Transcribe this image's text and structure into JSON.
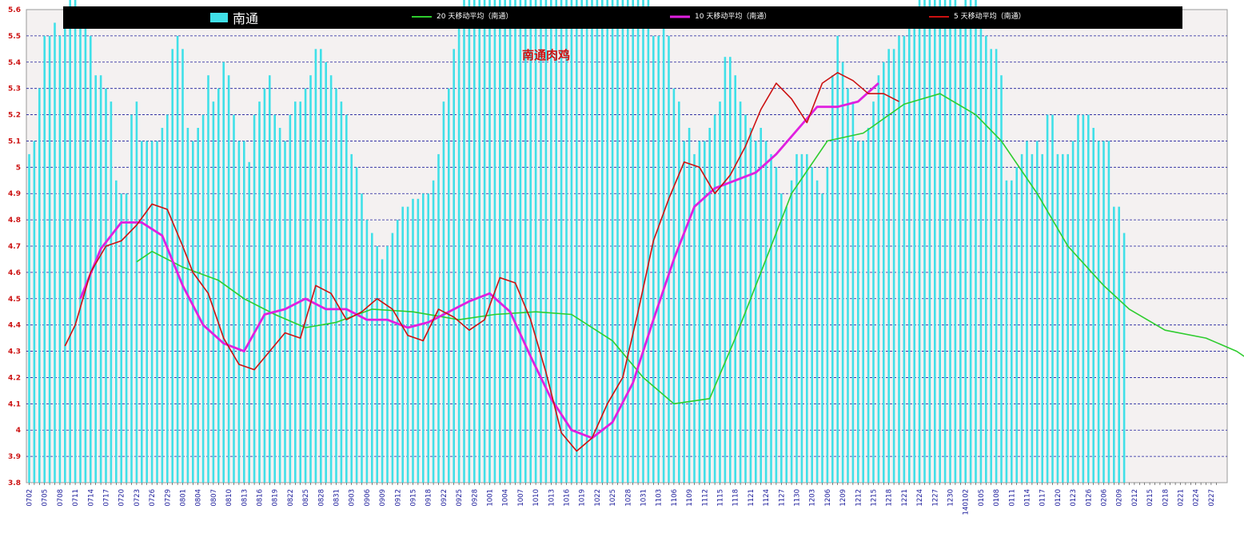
{
  "chart_data": {
    "type": "bar",
    "title": "南通肉鸡",
    "ylim": [
      3.8,
      5.6
    ],
    "y_ticks": [
      3.8,
      3.9,
      4.0,
      4.1,
      4.2,
      4.3,
      4.4,
      4.5,
      4.6,
      4.7,
      4.8,
      4.9,
      5.0,
      5.1,
      5.2,
      5.3,
      5.4,
      5.5,
      5.6
    ],
    "y_tick_labels": [
      "3.8",
      "3.9",
      "4",
      "4.1",
      "4.2",
      "4.3",
      "4.4",
      "4.5",
      "4.6",
      "4.7",
      "4.8",
      "4.9",
      "5",
      "5.1",
      "5.2",
      "5.3",
      "5.4",
      "5.5",
      "5.6"
    ],
    "grid": "horizontal dashed",
    "legend_position": "top",
    "legend": [
      {
        "label": "南通",
        "color": "#40e0e8",
        "kind": "bar"
      },
      {
        "label": "20 天移动平均（南通）",
        "color": "#2ecc2e",
        "kind": "line"
      },
      {
        "label": "10 天移动平均（南通）",
        "color": "#e020e0",
        "kind": "line"
      },
      {
        "label": "5 天移动平均（南通）",
        "color": "#cc1111",
        "kind": "line"
      }
    ],
    "x_tick_labels": [
      "0702",
      "0705",
      "0708",
      "0711",
      "0714",
      "0717",
      "0720",
      "0723",
      "0726",
      "0729",
      "0801",
      "0804",
      "0807",
      "0810",
      "0813",
      "0816",
      "0819",
      "0822",
      "0825",
      "0828",
      "0831",
      "0903",
      "0906",
      "0909",
      "0912",
      "0915",
      "0918",
      "0922",
      "0925",
      "0928",
      "1001",
      "1004",
      "1007",
      "1010",
      "1013",
      "1016",
      "1019",
      "1022",
      "1025",
      "1028",
      "1031",
      "1103",
      "1106",
      "1109",
      "1112",
      "1115",
      "1118",
      "1121",
      "1124",
      "1127",
      "1130",
      "1203",
      "1206",
      "1209",
      "1212",
      "1215",
      "1218",
      "1221",
      "1224",
      "1227",
      "1230",
      "140102",
      "0105",
      "0108",
      "0111",
      "0114",
      "0117",
      "0120",
      "0123",
      "0126",
      "0206",
      "0209",
      "0212",
      "0215",
      "0218",
      "0221",
      "0224",
      "0227"
    ],
    "bars": [
      1.25,
      1.3,
      1.5,
      1.7,
      1.7,
      1.75,
      1.7,
      1.75,
      1.9,
      1.9,
      1.8,
      1.75,
      1.7,
      1.55,
      1.55,
      1.5,
      1.45,
      1.15,
      1.1,
      1.1,
      1.4,
      1.45,
      1.3,
      1.3,
      1.3,
      1.3,
      1.35,
      1.4,
      1.65,
      1.7,
      1.65,
      1.35,
      1.3,
      1.35,
      1.4,
      1.55,
      1.45,
      1.5,
      1.6,
      1.55,
      1.4,
      1.3,
      1.3,
      1.22,
      1.4,
      1.45,
      1.5,
      1.55,
      1.4,
      1.35,
      1.3,
      1.4,
      1.45,
      1.45,
      1.5,
      1.55,
      1.65,
      1.65,
      1.6,
      1.55,
      1.5,
      1.45,
      1.4,
      1.25,
      1.2,
      1.1,
      1.0,
      0.95,
      0.9,
      0.85,
      0.9,
      0.95,
      1.0,
      1.05,
      1.05,
      1.08,
      1.08,
      1.1,
      1.1,
      1.15,
      1.25,
      1.45,
      1.5,
      1.65,
      1.75,
      1.85,
      1.95,
      2.05,
      2.05,
      2.0,
      1.95,
      1.85,
      1.85,
      1.9,
      1.95,
      2.05,
      2.2,
      2.15,
      2.1,
      2.15,
      2.2,
      2.25,
      2.35,
      2.35,
      2.35,
      2.2,
      2.15,
      2.15,
      2.15,
      2.15,
      2.2,
      2.3,
      2.7,
      2.7,
      2.35,
      2.3,
      2.3,
      2.3,
      2.25,
      2.2,
      2.1,
      1.9,
      1.7,
      1.7,
      1.8,
      1.7,
      1.5,
      1.45,
      1.3,
      1.35,
      1.25,
      1.3,
      1.3,
      1.35,
      1.4,
      1.45,
      1.62,
      1.62,
      1.55,
      1.45,
      1.4,
      1.35,
      1.3,
      1.35,
      1.3,
      1.25,
      1.2,
      1.1,
      1.05,
      1.15,
      1.25,
      1.25,
      1.25,
      1.2,
      1.15,
      1.1,
      1.2,
      1.55,
      1.7,
      1.6,
      1.5,
      1.45,
      1.3,
      1.3,
      1.35,
      1.45,
      1.55,
      1.6,
      1.65,
      1.65,
      1.7,
      1.7,
      1.75,
      1.8,
      1.85,
      1.85,
      1.9,
      1.9,
      1.9,
      1.9,
      1.85,
      1.85,
      1.8,
      1.85,
      1.95,
      1.85,
      1.8,
      1.7,
      1.65,
      1.65,
      1.55,
      1.15,
      1.15,
      1.2,
      1.25,
      1.3,
      1.25,
      1.3,
      1.25,
      1.4,
      1.4,
      1.25,
      1.25,
      1.25,
      1.3,
      1.4,
      1.4,
      1.4,
      1.35,
      1.3,
      1.3,
      1.3,
      1.05,
      1.05,
      0.95
    ],
    "series": [
      {
        "name": "20 天移动平均（南通）",
        "color": "#2ecc2e",
        "x": [
          21,
          24,
          30,
          37,
          42,
          48,
          54,
          60,
          67,
          75,
          84,
          91,
          99,
          106,
          114,
          120,
          126,
          133,
          138,
          143,
          149,
          156,
          163,
          171,
          178,
          185,
          190,
          197,
          203,
          210,
          215,
          222,
          230,
          236,
          239,
          246
        ],
        "y": [
          4.64,
          4.68,
          4.62,
          4.57,
          4.5,
          4.44,
          4.39,
          4.41,
          4.46,
          4.45,
          4.42,
          4.44,
          4.45,
          4.44,
          4.34,
          4.2,
          4.1,
          4.12,
          4.35,
          4.6,
          4.9,
          5.1,
          5.13,
          5.24,
          5.28,
          5.2,
          5.1,
          4.9,
          4.7,
          4.55,
          4.46,
          4.38,
          4.35,
          4.3,
          4.26,
          4.3
        ]
      },
      {
        "name": "10 天移动平均（南通）",
        "color": "#e020e0",
        "x": [
          10,
          14,
          18,
          22,
          26,
          30,
          34,
          38,
          42,
          46,
          50,
          54,
          58,
          62,
          66,
          70,
          74,
          78,
          82,
          86,
          90,
          94,
          98,
          102,
          106,
          110,
          114,
          118,
          122,
          126,
          130,
          134,
          138,
          142,
          146,
          150,
          154,
          158,
          162,
          166
        ],
        "y": [
          4.5,
          4.69,
          4.79,
          4.79,
          4.74,
          4.55,
          4.4,
          4.33,
          4.3,
          4.44,
          4.46,
          4.5,
          4.46,
          4.46,
          4.42,
          4.42,
          4.39,
          4.41,
          4.45,
          4.49,
          4.52,
          4.45,
          4.28,
          4.12,
          4.0,
          3.97,
          4.03,
          4.18,
          4.42,
          4.65,
          4.85,
          4.92,
          4.95,
          4.98,
          5.05,
          5.14,
          5.23,
          5.23,
          5.25,
          5.32
        ]
      },
      {
        "name": "5 天移动平均（南通）",
        "color": "#cc1111",
        "x": [
          7,
          9,
          12,
          15,
          18,
          21,
          24,
          27,
          30,
          32,
          35,
          38,
          41,
          44,
          47,
          50,
          53,
          56,
          59,
          62,
          65,
          68,
          71,
          74,
          77,
          80,
          83,
          86,
          89,
          92,
          95,
          98,
          101,
          104,
          107,
          110,
          113,
          116,
          119,
          122,
          125,
          128,
          131,
          134,
          137,
          140,
          143,
          146,
          149,
          152,
          155,
          158,
          161,
          164,
          167,
          170
        ],
        "y": [
          4.32,
          4.4,
          4.6,
          4.7,
          4.72,
          4.78,
          4.86,
          4.84,
          4.7,
          4.6,
          4.52,
          4.35,
          4.25,
          4.23,
          4.3,
          4.37,
          4.35,
          4.55,
          4.52,
          4.42,
          4.45,
          4.5,
          4.46,
          4.36,
          4.34,
          4.46,
          4.43,
          4.38,
          4.42,
          4.58,
          4.56,
          4.42,
          4.22,
          3.99,
          3.92,
          3.97,
          4.1,
          4.2,
          4.45,
          4.72,
          4.88,
          5.02,
          5.0,
          4.9,
          4.97,
          5.08,
          5.22,
          5.32,
          5.26,
          5.17,
          5.32,
          5.36,
          5.33,
          5.28,
          5.28,
          5.25
        ]
      }
    ]
  }
}
